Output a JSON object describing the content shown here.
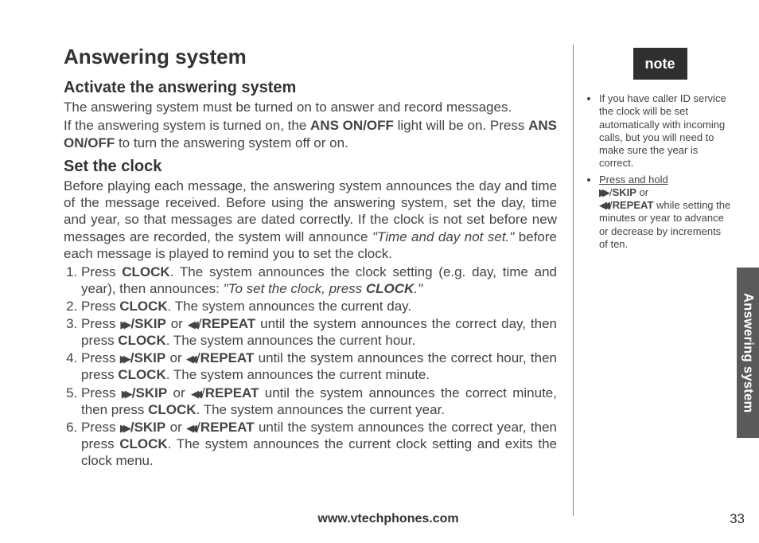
{
  "tab": "Answering system",
  "title": "Answering system",
  "section1": {
    "heading": "Activate the answering system",
    "p1": "The answering system must be turned on to answer and record messages.",
    "p2a": "If the answering system is turned on, the ",
    "p2b": "ANS ON/OFF",
    "p2c": " light will be on. Press ",
    "p2d": "ANS ON/OFF",
    "p2e": " to turn the answering system off or on."
  },
  "section2": {
    "heading": "Set the clock",
    "p1a": "Before playing each message, the answering system announces the day and time of the message received. Before using the answering system, set the day, time and year, so that messages are dated correctly. If the clock is not set before new messages are recorded, the system will announce ",
    "p1b": "\"Time and day not set.\"",
    "p1c": " before each message is played to remind you to set the clock.",
    "steps": {
      "s1a": "Press ",
      "s1b": "CLOCK",
      "s1c": ". The system announces the clock setting (e.g. day, time and year), then announces: ",
      "s1d": "\"To set the clock, press ",
      "s1e": "CLOCK",
      "s1f": ".\"",
      "s2a": "Press ",
      "s2b": "CLOCK",
      "s2c": ". The system announces the current day.",
      "s3a": "Press ",
      "s3b": "/SKIP",
      "s3c": " or ",
      "s3d": "REPEAT",
      "s3e": " until the system announces the correct day, then press ",
      "s3f": "CLOCK",
      "s3g": ". The system announces the current hour.",
      "s4a": "Press ",
      "s4b": "/SKIP",
      "s4c": " or ",
      "s4d": "REPEAT",
      "s4e": " until the system announces the correct hour, then press ",
      "s4f": "CLOCK",
      "s4g": ". The system announces the current minute.",
      "s5a": "Press ",
      "s5b": "/SKIP",
      "s5c": " or ",
      "s5d": "REPEAT",
      "s5e": " until the system announces the correct minute, then press ",
      "s5f": "CLOCK",
      "s5g": ". The system announces the current year.",
      "s6a": "Press ",
      "s6b": "/SKIP",
      "s6c": " or ",
      "s6d": "REPEAT",
      "s6e": " until the system announces the correct year, then press ",
      "s6f": "CLOCK",
      "s6g": ". The system announces the current clock setting and exits the clock menu."
    }
  },
  "note": {
    "label": "note",
    "item1": "If you have caller ID service the clock will be set automatically with incoming calls, but you will need to make sure the year is correct.",
    "item2a": "Press and hold",
    "item2b": "SKIP",
    "item2c": " or ",
    "item2d": "REPEAT",
    "item2e": " while setting the minutes or year to advance or decrease by increments of ten."
  },
  "footer": {
    "url": "www.vtechphones.com",
    "page": "33"
  }
}
